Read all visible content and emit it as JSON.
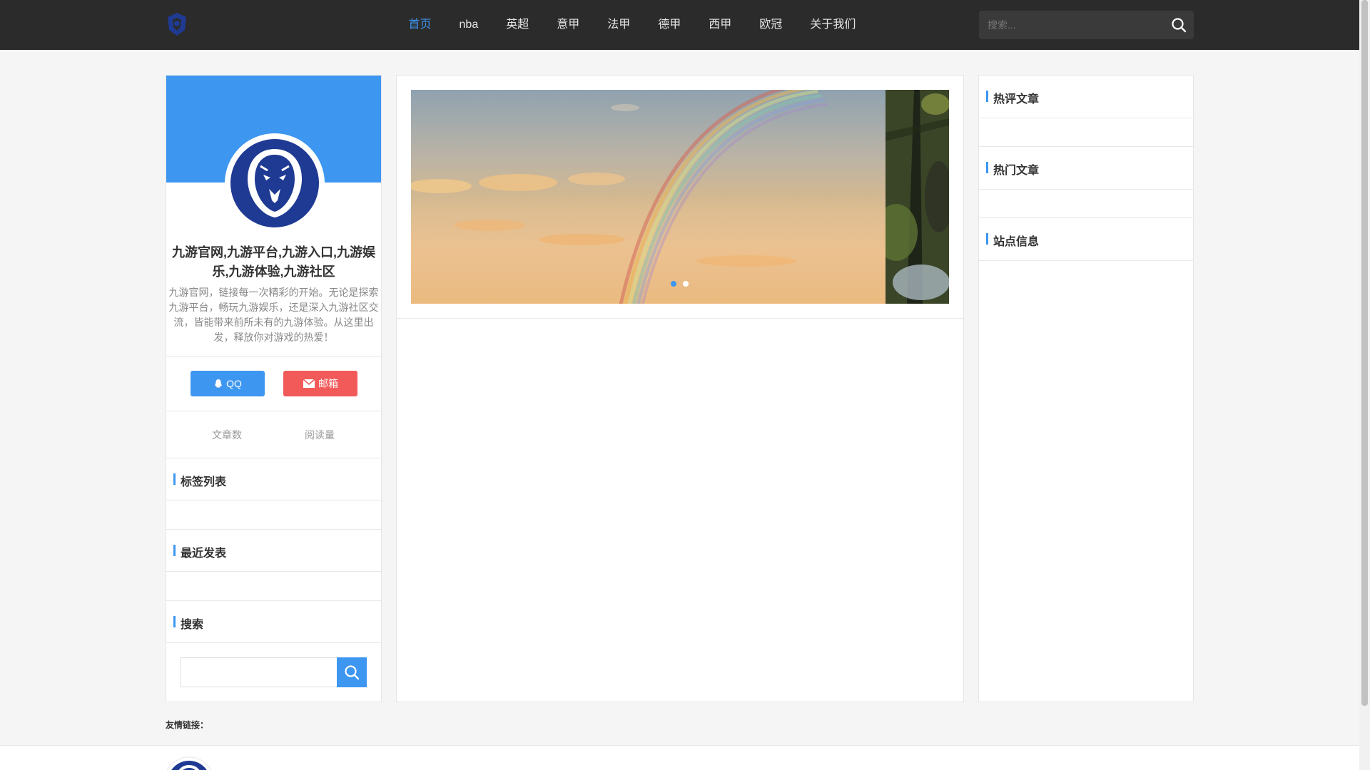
{
  "nav": {
    "items": [
      "首页",
      "nba",
      "英超",
      "意甲",
      "法甲",
      "德甲",
      "西甲",
      "欧冠",
      "关于我们"
    ],
    "active_index": 0,
    "search_placeholder": "搜索..."
  },
  "profile": {
    "title": "九游官网,九游平台,九游入口,九游娱乐,九游体验,九游社区",
    "description": "九游官网，链接每一次精彩的开始。无论是探索九游平台，畅玩九游娱乐，还是深入九游社区交流，皆能带来前所未有的九游体验。从这里出发，释放你对游戏的热爱！",
    "qq_label": "QQ",
    "mail_label": "邮箱",
    "stat_articles": "文章数",
    "stat_views": "阅读量"
  },
  "left_widgets": {
    "tags": "标签列表",
    "recent": "最近发表",
    "search": "搜索"
  },
  "right_widgets": {
    "hot_comments": "热评文章",
    "hot_articles": "热门文章",
    "site_info": "站点信息"
  },
  "slider": {
    "total": 2,
    "active": 0
  },
  "footer": {
    "links_label": "友情链接："
  },
  "colors": {
    "accent": "#3d96f0",
    "mail": "#f25a5a",
    "topbar": "#2b2b2b"
  }
}
